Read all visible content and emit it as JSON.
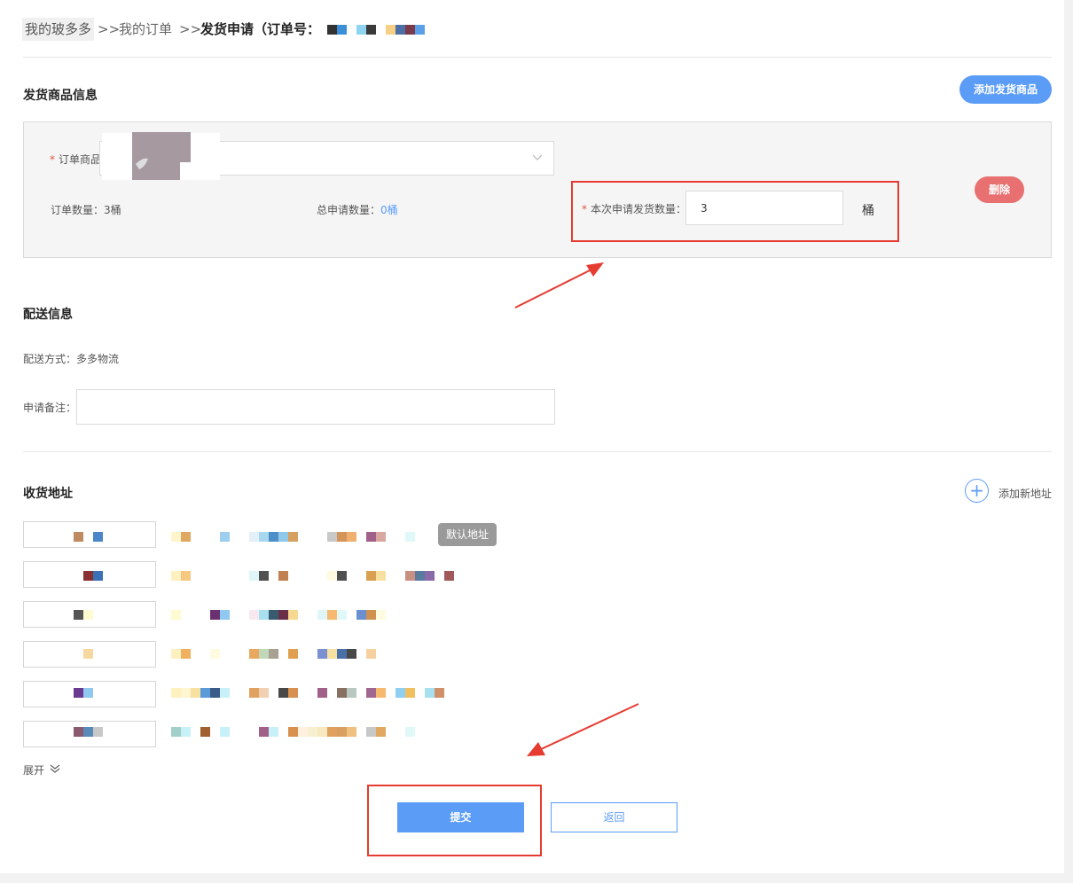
{
  "breadcrumb": {
    "home": "我的玻多多",
    "sep1": ">>",
    "orders": "我的订单",
    "sep2": ">>",
    "current": "发货申请（订单号："
  },
  "goods_section": {
    "title": "发货商品信息",
    "add_button": "添加发货商品",
    "product_label": "订单商品",
    "required_mark": "*",
    "order_qty_label": "订单数量：",
    "order_qty_value": "3桶",
    "total_apply_label": "总申请数量：",
    "total_apply_value": "0桶",
    "this_apply_label": "本次申请发货数量：",
    "this_apply_value": "3",
    "unit": "桶",
    "delete_button": "删除"
  },
  "delivery_section": {
    "title": "配送信息",
    "method_label": "配送方式：",
    "method_value": "多多物流",
    "remark_label": "申请备注：",
    "remark_value": ""
  },
  "address_section": {
    "title": "收货地址",
    "add_address": "添加新地址",
    "default_badge": "默认地址",
    "expand": "展开"
  },
  "actions": {
    "submit": "提交",
    "back": "返回"
  },
  "colors": {
    "primary": "#5b9cf7",
    "danger": "#e87070",
    "highlight": "#e63b30"
  }
}
